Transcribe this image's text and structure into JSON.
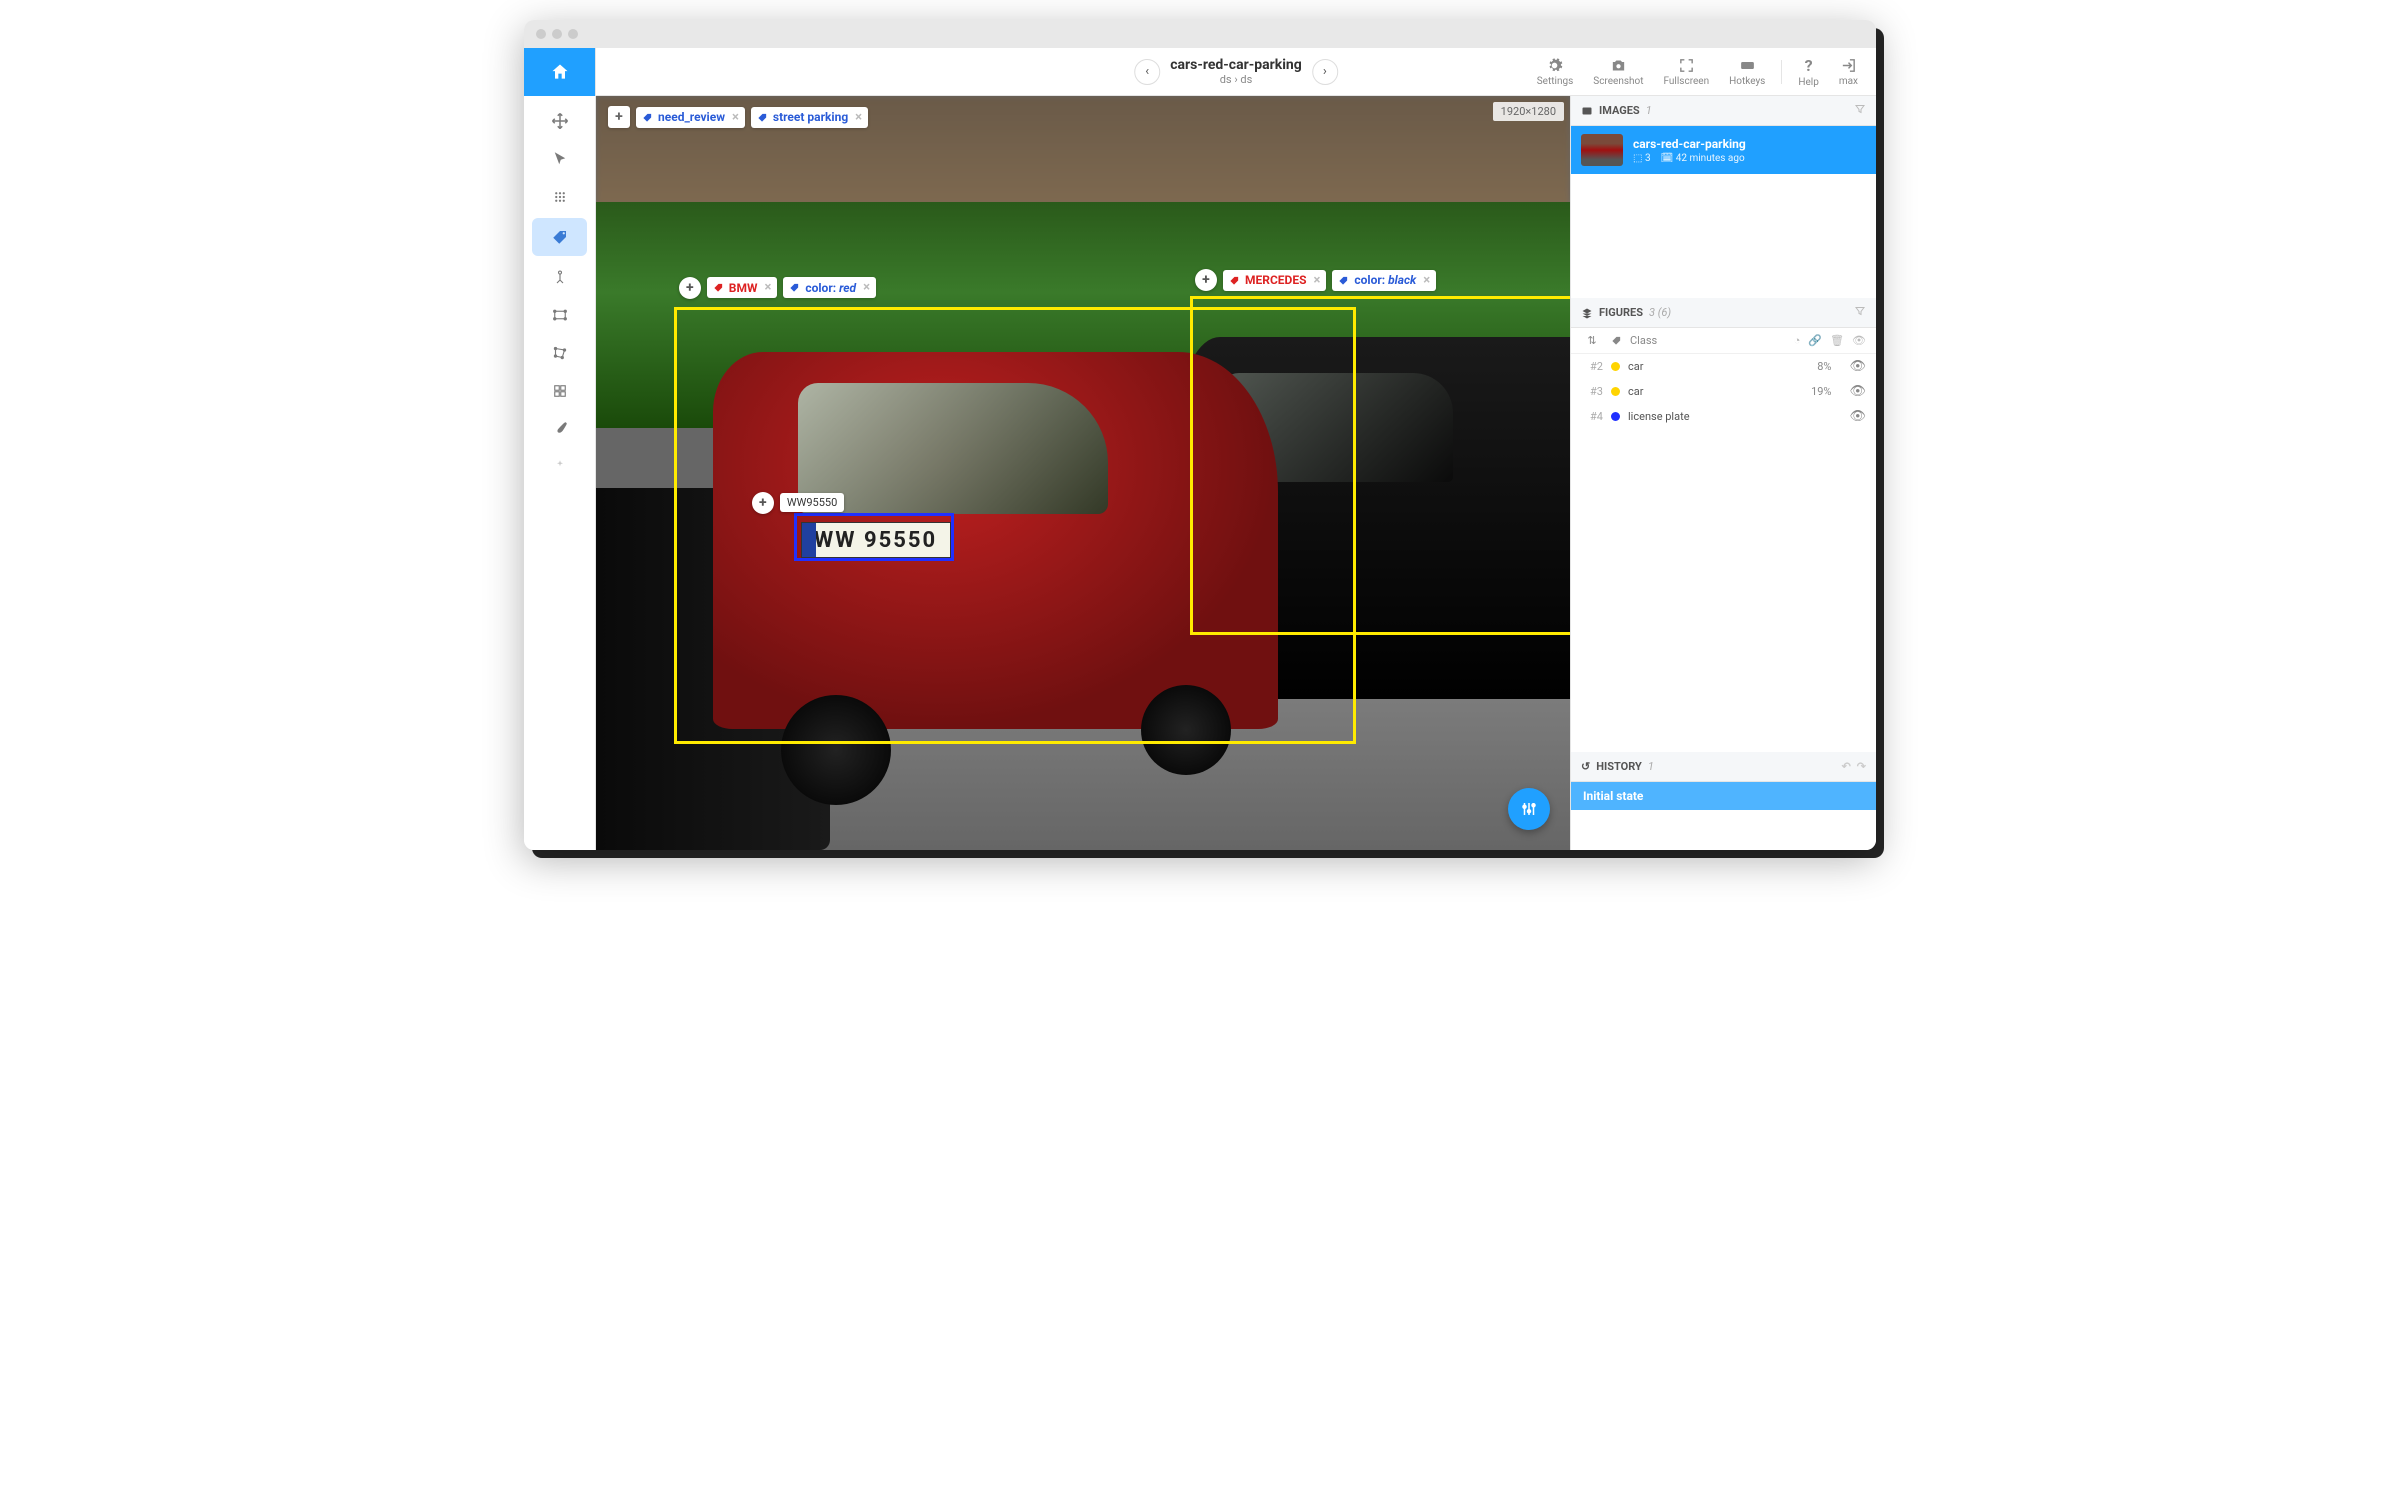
{
  "canvas": {
    "dimensions": "1920×1280"
  },
  "header": {
    "title": "cars-red-car-parking",
    "breadcrumb1": "ds",
    "breadcrumb2": "ds"
  },
  "toolbar": {
    "settings": "Settings",
    "screenshot": "Screenshot",
    "fullscreen": "Fullscreen",
    "hotkeys": "Hotkeys",
    "help": "Help",
    "user": "max"
  },
  "image_tags": [
    {
      "label": "need_review",
      "color": "#2a5bd7"
    },
    {
      "label": "street parking",
      "color": "#2a5bd7"
    }
  ],
  "annotations": {
    "bmw": {
      "class": "BMW",
      "class_color": "#d22",
      "attr_key": "color",
      "attr_val": "red",
      "attr_color": "#2a5bd7"
    },
    "mercedes": {
      "class": "MERCEDES",
      "class_color": "#d22",
      "attr_key": "color",
      "attr_val": "black",
      "attr_color": "#2a5bd7"
    },
    "plate": {
      "text": "WW95550",
      "display": "WW 95550"
    }
  },
  "images_panel": {
    "title": "IMAGES",
    "count": "1",
    "item": {
      "name": "cars-red-car-parking",
      "objects": "3",
      "time": "42 minutes ago"
    }
  },
  "figures_panel": {
    "title": "FIGURES",
    "count": "3 (6)",
    "class_header": "Class",
    "rows": [
      {
        "idx": "#2",
        "color": "#ffd400",
        "name": "car",
        "pct": "8%"
      },
      {
        "idx": "#3",
        "color": "#ffd400",
        "name": "car",
        "pct": "19%"
      },
      {
        "idx": "#4",
        "color": "#2030ff",
        "name": "license plate",
        "pct": ""
      }
    ]
  },
  "history_panel": {
    "title": "HISTORY",
    "count": "1",
    "item": "Initial state"
  }
}
